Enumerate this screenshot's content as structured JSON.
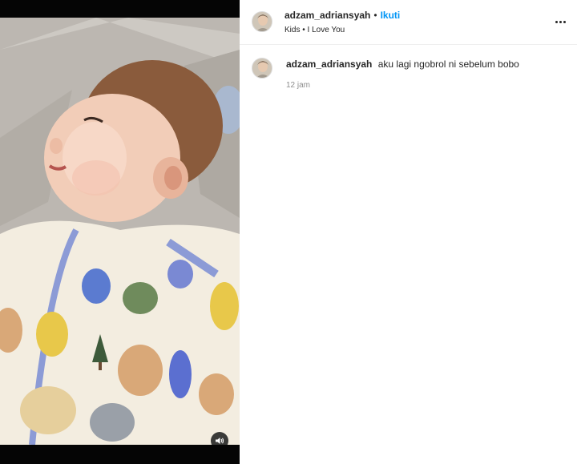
{
  "post": {
    "username": "adzam_adriansyah",
    "separator": "•",
    "follow_label": "Ikuti",
    "location": "Kids • I Love You",
    "more_icon": "more-horizontal-icon",
    "sound_icon": "speaker-icon"
  },
  "caption": {
    "username": "adzam_adriansyah",
    "text": "aku lagi ngobrol ni sebelum bobo",
    "timestamp": "12 jam"
  },
  "colors": {
    "follow": "#0095f6",
    "text": "#262626",
    "muted": "#8e8e8e"
  }
}
